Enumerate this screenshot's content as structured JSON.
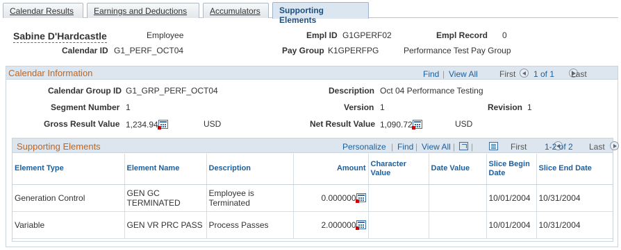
{
  "tabs": [
    {
      "label": "Calendar Results"
    },
    {
      "label": "Earnings and Deductions"
    },
    {
      "label": "Accumulators"
    },
    {
      "label": "Supporting Elements"
    }
  ],
  "header": {
    "name": "Sabine D'Hardcastle",
    "employee_type": "Employee",
    "empl_id_label": "Empl ID",
    "empl_id": "G1GPERF02",
    "empl_record_label": "Empl Record",
    "empl_record": "0",
    "calendar_id_label": "Calendar ID",
    "calendar_id": "G1_PERF_OCT04",
    "pay_group_label": "Pay Group",
    "pay_group": "K1GPERFPG",
    "pay_group_desc": "Performance Test Pay Group"
  },
  "calendar_info": {
    "title": "Calendar Information",
    "nav": {
      "find": "Find",
      "sep": "|",
      "view_all": "View All",
      "first": "First",
      "count": "1 of 1",
      "last": "Last"
    },
    "group_id_label": "Calendar Group ID",
    "group_id": "G1_GRP_PERF_OCT04",
    "description_label": "Description",
    "description": "Oct 04 Performance Testing",
    "segment_label": "Segment Number",
    "segment": "1",
    "version_label": "Version",
    "version": "1",
    "revision_label": "Revision",
    "revision": "1",
    "gross_label": "Gross Result Value",
    "gross": "1,234.94",
    "gross_currency": "USD",
    "net_label": "Net Result Value",
    "net": "1,090.72",
    "net_currency": "USD"
  },
  "supporting": {
    "title": "Supporting Elements",
    "nav": {
      "personalize": "Personalize",
      "sep": "|",
      "find": "Find",
      "view_all": "View All",
      "first": "First",
      "count": "1-2 of 2",
      "last": "Last"
    },
    "columns": [
      "Element Type",
      "Element Name",
      "Description",
      "Amount",
      "Character Value",
      "Date Value",
      "Slice Begin Date",
      "Slice End Date"
    ],
    "rows": [
      {
        "type": "Generation Control",
        "name": "GEN GC TERMINATED",
        "description": "Employee is Terminated",
        "amount": "0.000000",
        "char": "",
        "date": "",
        "begin": "10/01/2004",
        "end": "10/31/2004"
      },
      {
        "type": "Variable",
        "name": "GEN VR PRC PASS",
        "description": "Process Passes",
        "amount": "2.000000",
        "char": "",
        "date": "",
        "begin": "10/01/2004",
        "end": "10/31/2004"
      }
    ]
  }
}
